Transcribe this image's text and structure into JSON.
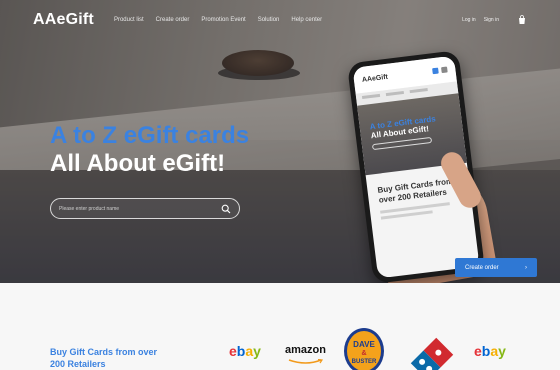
{
  "nav": {
    "logo": "AAeGift",
    "links": [
      "Product list",
      "Create order",
      "Promotion Event",
      "Solution",
      "Help center"
    ],
    "login": "Log in",
    "signup": "Sign in",
    "cart_icon": "shopping-bag-icon"
  },
  "hero": {
    "title_line1": "A to Z eGift cards",
    "title_line2": "All About eGift!",
    "search_placeholder": "Please enter product name",
    "search_icon": "search-icon",
    "cta_label": "Create order",
    "cta_icon": "arrow-right-icon"
  },
  "phone": {
    "logo": "AAeGift",
    "title_line1": "A to Z eGift cards",
    "title_line2": "All About eGift!",
    "card_title": "Buy Gift Cards from over 200 Retailers"
  },
  "retailers": {
    "title": "Buy Gift Cards from over 200 Retailers",
    "brands": [
      "ebay",
      "amazon",
      "Dave & Buster's",
      "Domino's",
      "ebay"
    ]
  },
  "colors": {
    "accent": "#3b82e0",
    "cta": "#2f78d4"
  }
}
